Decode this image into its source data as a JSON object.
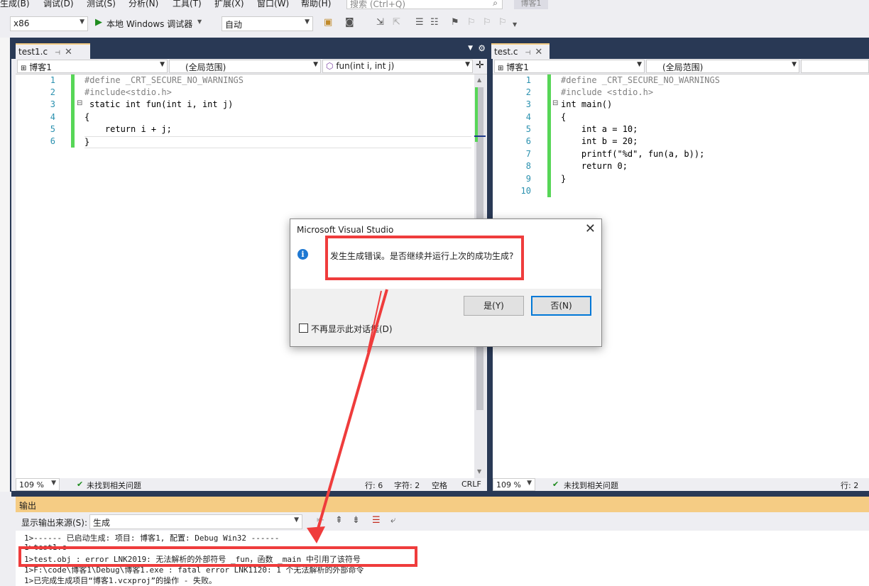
{
  "menu": {
    "items": [
      "生成(B)",
      "调试(D)",
      "测试(S)",
      "分析(N)",
      "工具(T)",
      "扩展(X)",
      "窗口(W)",
      "帮助(H)"
    ],
    "search_placeholder": "搜索 (Ctrl+Q)",
    "project_name": "博客1"
  },
  "toolbar": {
    "platform": "x86",
    "debugger": "本地 Windows 调试器",
    "debugger_mode": "自动"
  },
  "left_editor": {
    "tab": "test1.c",
    "nav_project": "博客1",
    "nav_scope": "(全局范围)",
    "nav_function": "fun(int i, int j)",
    "line_numbers": [
      "1",
      "2",
      "3",
      "4",
      "5",
      "6"
    ],
    "lines": [
      "#define _CRT_SECURE_NO_WARNINGS",
      "#include<stdio.h>",
      "static int fun(int i, int j)",
      "{",
      "    return i + j;",
      "}"
    ],
    "zoom": "109 %",
    "issues": "未找到相关问题",
    "status_line": "行: 6",
    "status_char": "字符: 2",
    "status_space": "空格",
    "status_eol": "CRLF"
  },
  "right_editor": {
    "tab": "test.c",
    "nav_project": "博客1",
    "nav_scope": "(全局范围)",
    "line_numbers": [
      "1",
      "2",
      "3",
      "4",
      "5",
      "6",
      "7",
      "8",
      "9",
      "10"
    ],
    "lines": [
      "#define _CRT_SECURE_NO_WARNINGS",
      "#include <stdio.h>",
      "int main()",
      "{",
      "    int a = 10;",
      "    int b = 20;",
      "    printf(\"%d\", fun(a, b));",
      "    return 0;",
      "}",
      ""
    ],
    "zoom": "109 %",
    "issues": "未找到相关问题",
    "status_line": "行: 2"
  },
  "output": {
    "header": "输出",
    "source_label": "显示输出来源(S):",
    "source_value": "生成",
    "lines": [
      "1>------ 已启动生成: 项目: 博客1, 配置: Debug Win32 ------",
      "1>test1.c",
      "1>test.obj : error LNK2019: 无法解析的外部符号 _fun，函数 _main 中引用了该符号",
      "1>F:\\code\\博客1\\Debug\\博客1.exe : fatal error LNK1120: 1 个无法解析的外部命令",
      "1>已完成生成项目“博客1.vcxproj”的操作 - 失败。"
    ]
  },
  "dialog": {
    "title": "Microsoft Visual Studio",
    "message": "发生生成错误。是否继续并运行上次的成功生成?",
    "yes_label": "是(Y)",
    "no_label": "否(N)",
    "checkbox_label": "不再显示此对话框(D)"
  },
  "colors": {
    "accent_tab": "#f5cc84",
    "chrome_dark": "#293955",
    "annotation_red": "#ef3c3c"
  }
}
